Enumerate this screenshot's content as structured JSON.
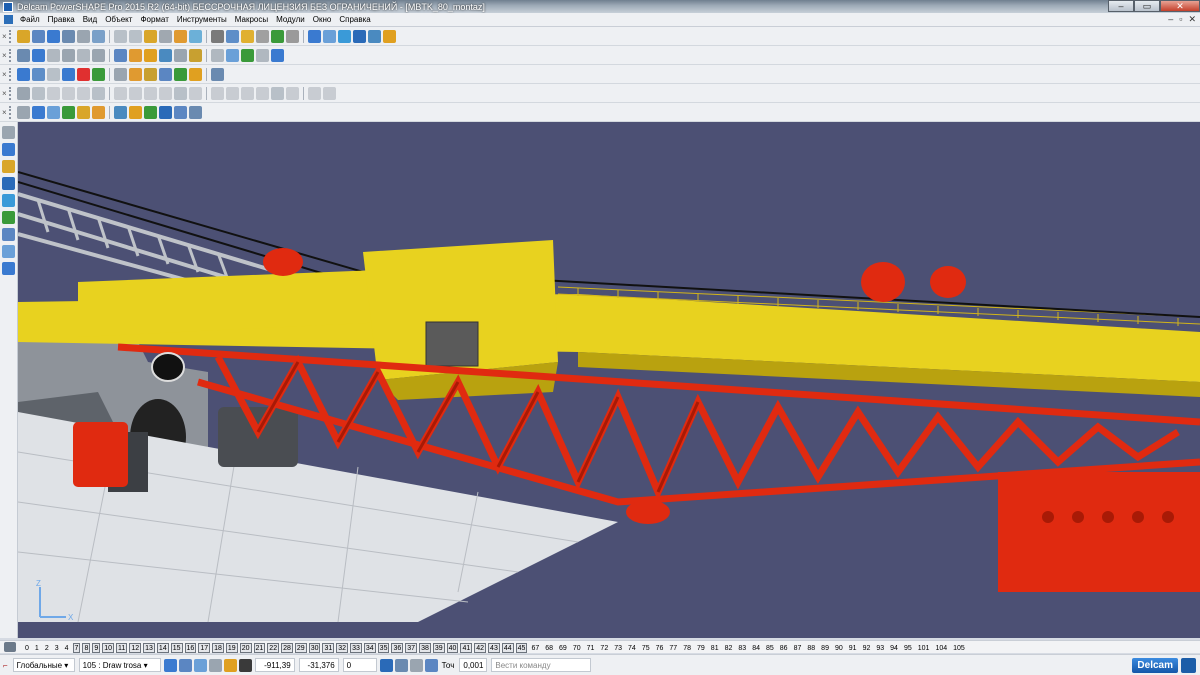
{
  "window": {
    "title": "Delcam PowerSHAPE Pro 2015 R2 (64-bit) БЕССРОЧНАЯ ЛИЦЕНЗИЯ БЕЗ ОГРАНИЧЕНИЙ - [MBTK_80_montaz]",
    "minimize": "–",
    "maximize": "▭",
    "close": "✕"
  },
  "menu": {
    "items": [
      "Файл",
      "Правка",
      "Вид",
      "Объект",
      "Формат",
      "Инструменты",
      "Макросы",
      "Модули",
      "Окно",
      "Справка"
    ],
    "mdi": [
      "–",
      "▫",
      "✕"
    ]
  },
  "toolbars": {
    "row1_colors": [
      "#d9a629",
      "#5b86c2",
      "#3a7ad0",
      "#6a8ab0",
      "#9aa5b0",
      "#7aa0c8",
      "#b8c0c8",
      "#b8c0c8",
      "#d9a629",
      "#a0a8b0",
      "#e09a30",
      "#6cb0d8",
      "#7a7a7a",
      "#5e8ec8",
      "#e0b030",
      "#a0a0a0",
      "#3a9a3a",
      "#9a9a9a",
      "#3a7ad0",
      "#6aa0d8",
      "#3a9ad8",
      "#2a6ab8",
      "#4a8ac0",
      "#e0a020"
    ],
    "row2_colors": [
      "#6a8ab0",
      "#3a7ad0",
      "#b0b8c0",
      "#9aa5b0",
      "#b0b8c0",
      "#9aa5b0",
      "#5b86c2",
      "#e09a30",
      "#e0a020",
      "#4a8ac0",
      "#9aa5b0",
      "#c8a030",
      "#b0b8c0",
      "#6aa0d8",
      "#3a9a3a",
      "#b0b8c0",
      "#3a7ad0"
    ],
    "row3_colors": [
      "#3a7ad0",
      "#5e8ec8",
      "#b8c0c8",
      "#3a7ad0",
      "#e03030",
      "#3a9a3a",
      "#9aa5b0",
      "#e09a30",
      "#c8a030",
      "#5b86c2",
      "#3a9a3a",
      "#e0a020",
      "#6a8ab0"
    ],
    "row4_colors": [
      "#9aa5b0",
      "#b8c0c8",
      "#c8ccd2",
      "#c8ccd2",
      "#c8ccd2",
      "#b8c0c8",
      "#c8ccd2",
      "#c8ccd2",
      "#c8ccd2",
      "#c8ccd2",
      "#b8c0c8",
      "#c8ccd2",
      "#c8ccd2",
      "#c8ccd2",
      "#c8ccd2",
      "#c8ccd2",
      "#b8c0c8",
      "#c8ccd2",
      "#c8ccd2",
      "#c8ccd2"
    ],
    "row5_colors": [
      "#9aa5b0",
      "#3a7ad0",
      "#6aa0d8",
      "#3a9a3a",
      "#d9a629",
      "#e09a30",
      "#4a8ac0",
      "#e0a020",
      "#3a9a3a",
      "#2a6ab8",
      "#5b86c2",
      "#6a8ab0"
    ],
    "left_colors": [
      "#9aa5b0",
      "#3a7ad0",
      "#d9a629",
      "#2a6ab8",
      "#3a9ad8",
      "#3a9a3a",
      "#5b86c2",
      "#6aa0d8",
      "#3a7ad0"
    ]
  },
  "colors": {
    "viewport_bg": "#4c5074",
    "boom_yellow": "#e8d21f",
    "boom_yellow_dark": "#b9a20f",
    "truss_red": "#e02a10",
    "truss_red_dark": "#a81a06",
    "platform": "#dfe2e6"
  },
  "axis": {
    "x": "X",
    "z": "Z"
  },
  "levels": {
    "plain": [
      "0",
      "1",
      "2",
      "3",
      "4"
    ],
    "boxed": [
      "7",
      "8",
      "9",
      "10",
      "11",
      "12",
      "13",
      "14",
      "15",
      "16",
      "17",
      "18",
      "19",
      "20",
      "21",
      "22",
      "28",
      "29",
      "30",
      "31",
      "32",
      "33",
      "34",
      "35",
      "36",
      "37",
      "38",
      "39",
      "40",
      "41",
      "42",
      "43",
      "44",
      "45"
    ],
    "tail": [
      "67",
      "68",
      "69",
      "70",
      "71",
      "72",
      "73",
      "74",
      "75",
      "76",
      "77",
      "78",
      "79",
      "81",
      "82",
      "83",
      "84",
      "85",
      "86",
      "87",
      "88",
      "89",
      "90",
      "91",
      "92",
      "93",
      "94",
      "95",
      "101",
      "104",
      "105"
    ]
  },
  "status": {
    "workplane": "Глобальные ▾",
    "level_select": "105 : Draw trosa ▾",
    "x": "-911,39",
    "y": "-31,376",
    "z": "0",
    "tol_label": "Точ",
    "tol_value": "0,001",
    "command_placeholder": "Вести команду",
    "brand": "Delcam"
  }
}
